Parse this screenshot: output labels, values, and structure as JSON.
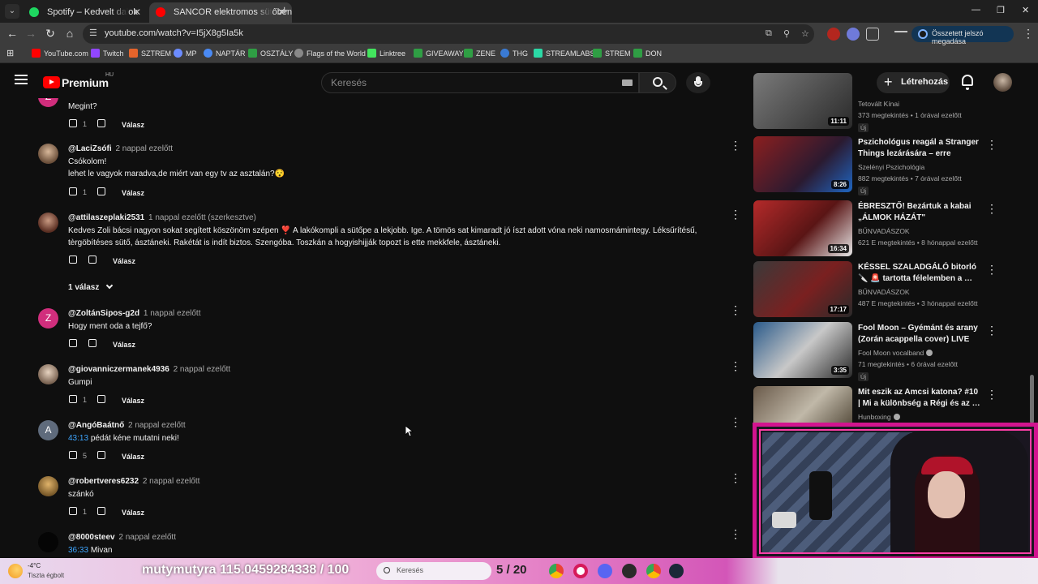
{
  "browser": {
    "tabs": [
      {
        "title": "Spotify – Kedvelt dalok",
        "favicon_color": "#1ed760"
      },
      {
        "title": "SANCOR elektromos sütőben f",
        "favicon_color": "#ff0000",
        "active": true
      }
    ],
    "url": "youtube.com/watch?v=I5jX8g5Ia5k",
    "signin_label": "Összetett jelszó megadása",
    "bookmarks": [
      {
        "label": "YouTube.com",
        "color": "#ff0000"
      },
      {
        "label": "Twitch",
        "color": "#9146ff"
      },
      {
        "label": "SZTREM",
        "color": "#e5642b"
      },
      {
        "label": "MP",
        "color": "#6c8cff"
      },
      {
        "label": "NAPTÁR",
        "color": "#4a8af4"
      },
      {
        "label": "OSZTÁLY",
        "color": "#2f9e44"
      },
      {
        "label": "Flags of the World",
        "color": "#888888"
      },
      {
        "label": "Linktree",
        "color": "#43e55e"
      },
      {
        "label": "GIVEAWAY",
        "color": "#2f9e44"
      },
      {
        "label": "ZENE",
        "color": "#2f9e44"
      },
      {
        "label": "THG",
        "color": "#3a7bd5"
      },
      {
        "label": "STREAMLABS",
        "color": "#2bd9a6"
      },
      {
        "label": "STREM",
        "color": "#2f9e44"
      },
      {
        "label": "DON",
        "color": "#2f9e44"
      }
    ]
  },
  "header": {
    "logo": "Premium",
    "region": "HU",
    "search_placeholder": "Keresés",
    "create_label": "Létrehozás"
  },
  "comments": [
    {
      "author": "",
      "time": "",
      "text": "Megint?",
      "likes": "1",
      "reply": "Válasz"
    },
    {
      "author": "@LaciZsófi",
      "time": "2 nappal ezelőtt",
      "text": "Csókolom!\n lehet le vagyok maradva,de miért van egy tv az asztalán?😯",
      "likes": "1",
      "reply": "Válasz"
    },
    {
      "author": "@attilaszeplaki2531",
      "time": "1 nappal ezelőtt (szerkesztve)",
      "text": "Kedves Zoli bácsi nagyon sokat segített köszönöm szépen ❣️ A lakókompli a sütőpe a lekjobb. Ige. A tömös sat kimaradt jó íszt adott vóna neki namosmámintegy. Léksűrítésű, tèrgöbítéses sütő, ásztáneki. Rakétát is indít biztos. Szengóba. Toszkán a hogyishijják topozt is ette mekkfele, ásztáneki.",
      "likes": "",
      "reply": "Válasz",
      "replies_label": "1 válasz"
    },
    {
      "author": "@ZoltánSipos-g2d",
      "time": "1 nappal ezelőtt",
      "text": "Hogy ment oda a tejfő?",
      "likes": "",
      "reply": "Válasz",
      "initial": "Z"
    },
    {
      "author": "@giovanniczermanek4936",
      "time": "2 nappal ezelőtt",
      "text": "Gumpi",
      "likes": "1",
      "reply": "Válasz"
    },
    {
      "author": "@AngóBaátnő",
      "time": "2 nappal ezelőtt",
      "timestamp_link": "43:13",
      "text": "pédát kéne mutatni neki!",
      "likes": "5",
      "reply": "Válasz",
      "initial": "A"
    },
    {
      "author": "@robertveres6232",
      "time": "2 nappal ezelőtt",
      "text": "szánkó",
      "likes": "1",
      "reply": "Válasz"
    },
    {
      "author": "@8000steev",
      "time": "2 nappal ezelőtt",
      "timestamp_link": "36:33",
      "text": "Mivan"
    }
  ],
  "recommendations": [
    {
      "title": "",
      "channel": "Tetovált Kínai",
      "meta": "373 megtekintés • 1 órával ezelőtt",
      "badge": "Új",
      "duration": "11:11",
      "thumb_color": "#5a5a5a"
    },
    {
      "title": "Pszichológus reagál a Stranger Things lezárására – erre senki…",
      "channel": "Szelényi Pszichológia",
      "meta": "882 megtekintés • 7 órával ezelőtt",
      "badge": "Új",
      "duration": "8:26",
      "thumb_color": "#6b1a1a"
    },
    {
      "title": "ÉBRESZTŐ! Bezártuk a kabai „ÁLMOK HÁZÁT\" (Bűnvadászo…",
      "channel": "BŰNVADÁSZOK",
      "meta": "621 E megtekintés • 8 hónappal ezelőtt",
      "duration": "16:34",
      "thumb_color": "#8b1d1d"
    },
    {
      "title": "KÉSSEL SZALADGÁLÓ bitorló 🔪 🚨 tartotta félelemben a …",
      "channel": "BŰNVADÁSZOK",
      "meta": "487 E megtekintés • 3 hónappal ezelőtt",
      "duration": "17:17",
      "thumb_color": "#4a3030"
    },
    {
      "title": "Fool Moon – Gyémánt és arany (Zorán acappella cover) LIVE",
      "channel": "Fool Moon vocalband",
      "meta": "71 megtekintés • 6 órával ezelőtt",
      "badge": "Új",
      "duration": "3:35",
      "thumb_color": "#304a6a"
    },
    {
      "title": "Mit eszik az Amcsi katona? #10 | Mi a különbség a Régi és az …",
      "channel": "Hunboxing",
      "meta": "",
      "duration": "",
      "thumb_color": "#5a5040"
    }
  ],
  "taskbar": {
    "temp": "-4°C",
    "condition": "Tiszta égbolt",
    "ticker": "mutymutyra  115.0459284338  /  100",
    "search_placeholder": "Keresés",
    "pager": "5 / 20"
  }
}
